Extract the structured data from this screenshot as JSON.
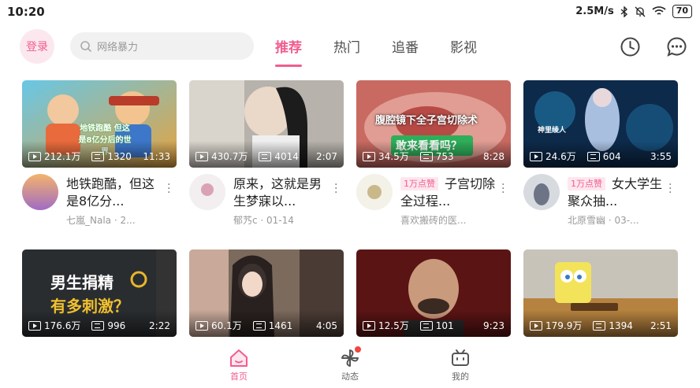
{
  "status_bar": {
    "time": "10:20",
    "speed": "2.5M/s",
    "battery": "70"
  },
  "header": {
    "login_label": "登录",
    "search_placeholder": "网络暴力",
    "tabs": [
      {
        "label": "推荐",
        "active": true
      },
      {
        "label": "热门",
        "active": false
      },
      {
        "label": "追番",
        "active": false
      },
      {
        "label": "影视",
        "active": false
      }
    ],
    "history_icon": "clock-icon",
    "message_icon": "chat-bubble-icon"
  },
  "feed": [
    {
      "title": "地铁跑酷，但这是8亿分...",
      "author": "七嵐_Nala · 2...",
      "views": "212.1万",
      "danmaku": "1320",
      "duration": "11:33",
      "badge": "",
      "overlay_text": "地铁跑酷 但这是8亿分后的世界"
    },
    {
      "title": "原来，这就是男生梦寐以...",
      "author": "郁艿c · 01-14",
      "views": "430.7万",
      "danmaku": "4014",
      "duration": "2:07",
      "badge": "",
      "overlay_text": ""
    },
    {
      "title": "子宫切除全过程...",
      "author": "喜欢搬砖的医...",
      "views": "34.5万",
      "danmaku": "753",
      "duration": "8:28",
      "badge": "1万点赞",
      "overlay_text": "腹腔镜下全子宫切除术",
      "overlay_text2": "敢来看看吗？"
    },
    {
      "title": "女大学生聚众抽...",
      "author": "北原雪幽 · 03-...",
      "views": "24.6万",
      "danmaku": "604",
      "duration": "3:55",
      "badge": "1万点赞",
      "overlay_text": "神里绫人"
    },
    {
      "title": "",
      "author": "",
      "views": "176.6万",
      "danmaku": "996",
      "duration": "2:22",
      "badge": "",
      "overlay_text": "男生捐精",
      "overlay_text2": "有多刺激？"
    },
    {
      "title": "",
      "author": "",
      "views": "60.1万",
      "danmaku": "1461",
      "duration": "4:05",
      "badge": "",
      "overlay_text": ""
    },
    {
      "title": "",
      "author": "",
      "views": "12.5万",
      "danmaku": "101",
      "duration": "9:23",
      "badge": "",
      "overlay_text": ""
    },
    {
      "title": "",
      "author": "",
      "views": "179.9万",
      "danmaku": "1394",
      "duration": "2:51",
      "badge": "",
      "overlay_text": ""
    }
  ],
  "bottom_nav": [
    {
      "label": "首页",
      "icon": "home-icon",
      "active": true
    },
    {
      "label": "动态",
      "icon": "pinwheel-icon",
      "active": false,
      "has_dot": true
    },
    {
      "label": "我的",
      "icon": "tv-icon",
      "active": false
    }
  ],
  "colors": {
    "accent": "#f25d8e",
    "badge_bg": "#fde7ee",
    "dot": "#f0473f"
  }
}
